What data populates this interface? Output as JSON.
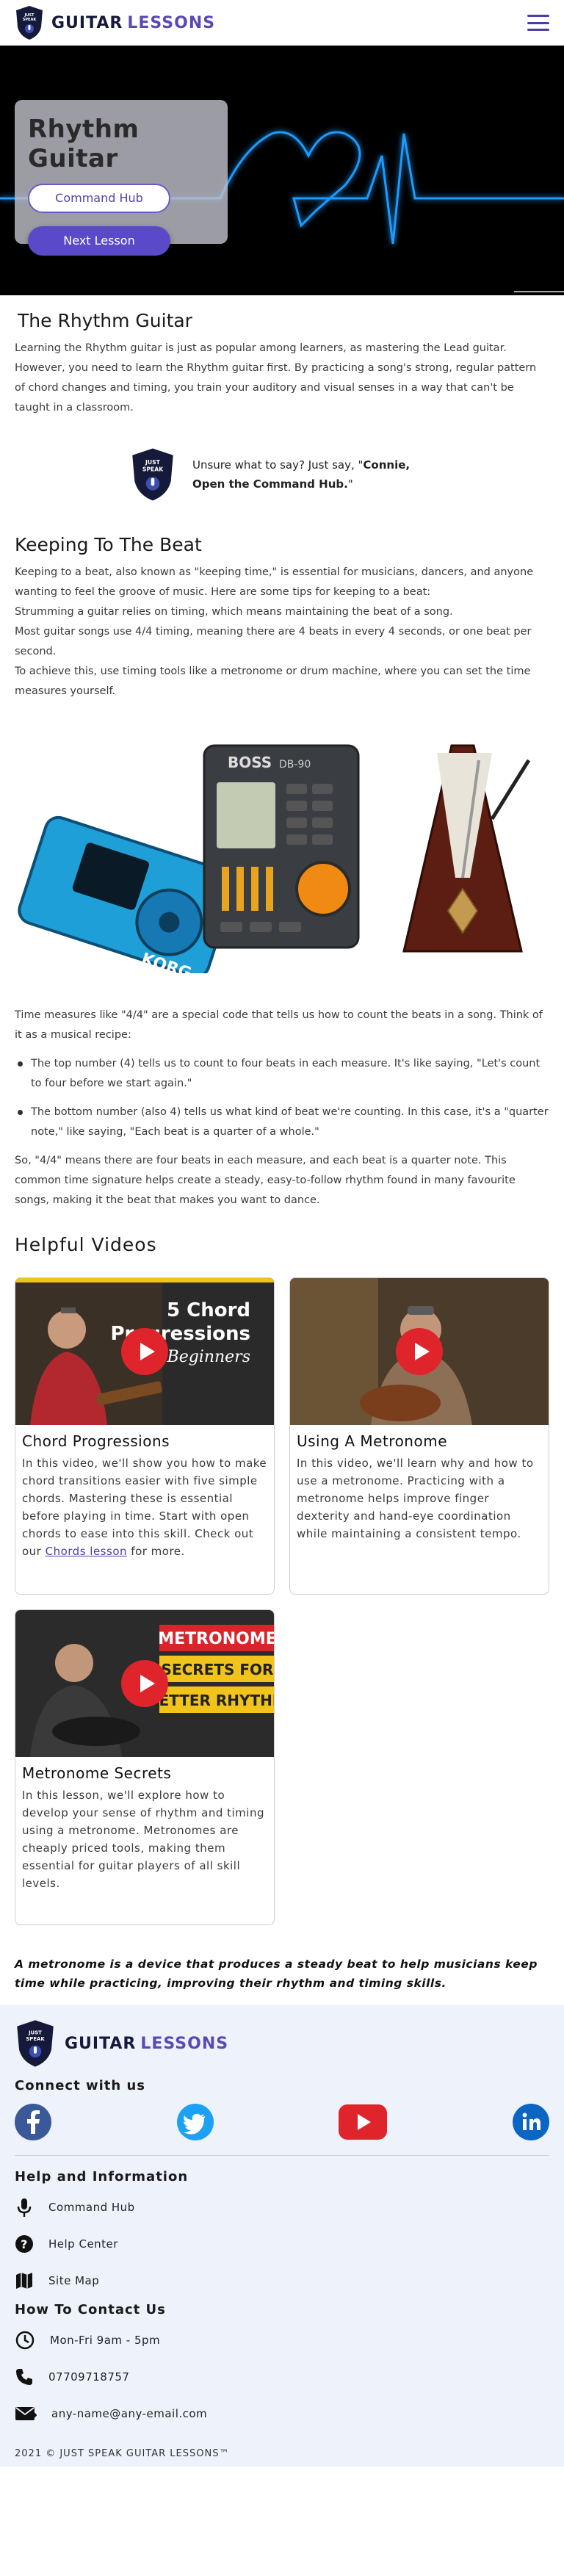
{
  "header": {
    "brand_word1": "GUITAR",
    "brand_word2": "LESSONS",
    "logo_text": "JUST SPEAK",
    "menu_icon": "hamburger-menu-icon"
  },
  "hero": {
    "title": "Rhythm Guitar",
    "command_hub_button": "Command Hub",
    "next_lesson_button": "Next Lesson"
  },
  "intro": {
    "title": "The Rhythm Guitar",
    "text": "Learning the Rhythm guitar is just as popular among learners, as mastering the Lead guitar. However, you need to learn the Rhythm guitar first. By practicing a song's strong, regular pattern of chord changes and timing, you train your auditory and visual senses in a way that can't be taught in a classroom."
  },
  "tip": {
    "prefix": "Unsure what to say? Just say, \"",
    "command": "Connie, Open the Command Hub.",
    "suffix": "\""
  },
  "beat": {
    "title": "Keeping To The Beat",
    "p1": "Keeping to a beat, also known as \"keeping time,\" is essential for musicians, dancers, and anyone wanting to feel the groove of music. Here are some tips for keeping to a beat:",
    "p2": "Strumming a guitar relies on timing, which means maintaining the beat of a song.",
    "p3": "Most guitar songs use 4/4 timing, meaning there are 4 beats in every 4 seconds, or one beat per second.",
    "p4": "To achieve this, use timing tools like a metronome or drum machine, where you can set the time measures yourself.",
    "device_label_boss": "BOSS",
    "device_label_model": "DB-90",
    "device_label_korg": "KORG"
  },
  "time_measures": {
    "intro": "Time measures like \"4/4\" are a special code that tells us how to count the beats in a song. Think of it as a musical recipe:",
    "bullets": [
      "The top number (4) tells us to count to four beats in each measure. It's like saying, \"Let's count to four before we start again.\"",
      "The bottom number (also 4) tells us what kind of beat we're counting. In this case, it's a \"quarter note,\" like saying, \"Each beat is a quarter of a whole.\""
    ],
    "outro": "So, \"4/4\" means there are four beats in each measure, and each beat is a quarter note. This common time signature helps create a steady, easy-to-follow rhythm found in many favourite songs, making it the beat that makes you want to dance."
  },
  "videos": {
    "title": "Helpful Videos",
    "items": [
      {
        "title": "Chord Progressions",
        "thumb_line1": "5 Chord",
        "thumb_line2": "Progressions",
        "thumb_line3": "for Beginners",
        "desc": "In this video, we'll show you how to make chord transitions easier with five simple chords. Mastering these is essential before playing in time. Start with open chords to ease into this skill. Check out our ",
        "link": "Chords lesson",
        "desc_end": " for more."
      },
      {
        "title": "Using A Metronome",
        "desc": "In this video, we'll learn why and how to use a metronome. Practicing with a metronome helps improve finger dexterity and hand-eye coordination while maintaining a consistent tempo."
      },
      {
        "title": "Metronome Secrets",
        "thumb_line1": "METRONOME",
        "thumb_line2": "SECRETS FOR",
        "thumb_line3": "BETTER RHYTHM",
        "desc": "In this lesson, we'll explore how to develop your sense of rhythm and timing using a metronome. Metronomes are cheaply priced tools, making them essential for guitar players of all skill levels."
      }
    ]
  },
  "quote": "A metronome is a device that produces a steady beat to help musicians keep time while practicing, improving their rhythm and timing skills.",
  "footer": {
    "connect_title": "Connect with us",
    "social_icons": [
      "facebook-icon",
      "twitter-icon",
      "youtube-icon",
      "linkedin-icon"
    ],
    "help_title": "Help and Information",
    "help_items": [
      "Command Hub",
      "Help Center",
      "Site Map"
    ],
    "contact_title": "How To Contact Us",
    "hours": "Mon-Fri 9am - 5pm",
    "phone": "07709718757",
    "email": "any-name@any-email.com",
    "copyright": "2021 © JUST SPEAK GUITAR LESSONS™"
  },
  "colors": {
    "brand_dark": "#161a3a",
    "brand_purple": "#5849b5",
    "button_purple": "#5a49c9",
    "footer_bg": "#eef3fb",
    "youtube_red": "#e0242b"
  }
}
